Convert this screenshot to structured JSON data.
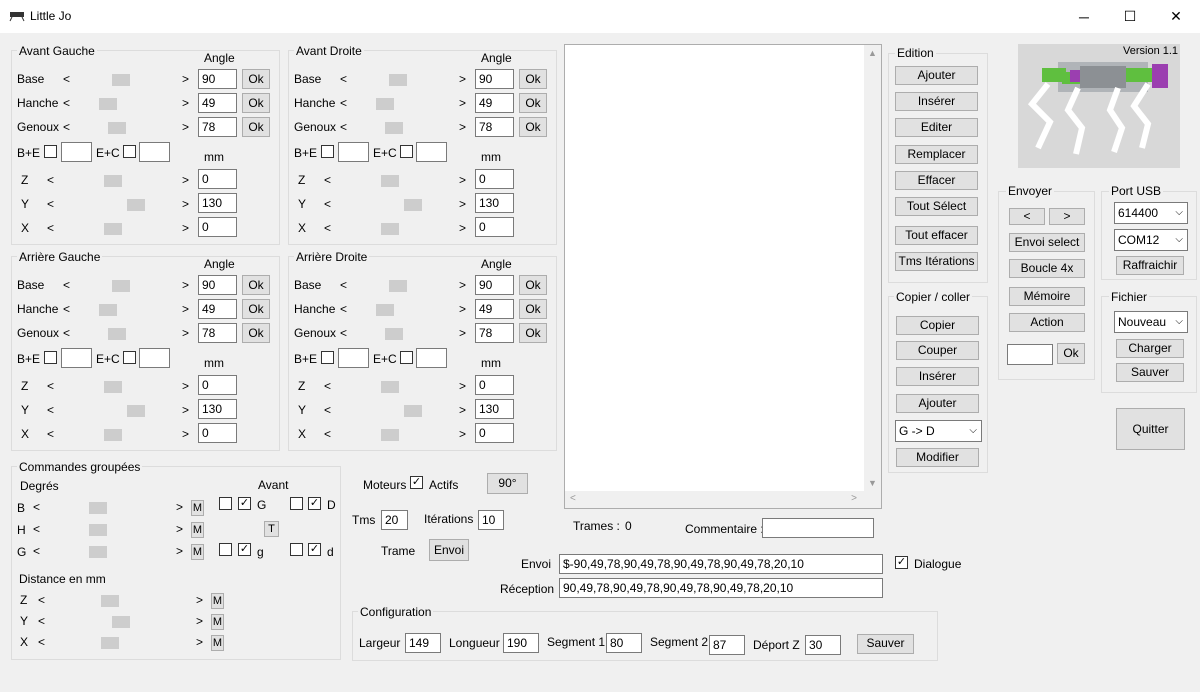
{
  "window": {
    "title": "Little Jo",
    "minimize": "─",
    "maximize": "☐",
    "close": "✕"
  },
  "legs": [
    {
      "title": "Avant Gauche",
      "angle_label": "Angle",
      "mm_label": "mm",
      "rows": [
        {
          "label": "Base",
          "value": "90",
          "ok": "Ok",
          "thumb": 0.5
        },
        {
          "label": "Hanche",
          "value": "49",
          "ok": "Ok",
          "thumb": 0.33
        },
        {
          "label": "Genoux",
          "value": "78",
          "ok": "Ok",
          "thumb": 0.45
        }
      ],
      "be": "B+E",
      "ec": "E+C",
      "xyz": [
        {
          "label": "Z",
          "value": "0",
          "thumb": 0.5
        },
        {
          "label": "Y",
          "value": "130",
          "thumb": 0.75
        },
        {
          "label": "X",
          "value": "0",
          "thumb": 0.5
        }
      ]
    },
    {
      "title": "Avant Droite",
      "angle_label": "Angle",
      "mm_label": "mm",
      "rows": [
        {
          "label": "Base",
          "value": "90",
          "ok": "Ok",
          "thumb": 0.5
        },
        {
          "label": "Hanche",
          "value": "49",
          "ok": "Ok",
          "thumb": 0.33
        },
        {
          "label": "Genoux",
          "value": "78",
          "ok": "Ok",
          "thumb": 0.45
        }
      ],
      "be": "B+E",
      "ec": "E+C",
      "xyz": [
        {
          "label": "Z",
          "value": "0",
          "thumb": 0.5
        },
        {
          "label": "Y",
          "value": "130",
          "thumb": 0.75
        },
        {
          "label": "X",
          "value": "0",
          "thumb": 0.5
        }
      ]
    },
    {
      "title": "Arrière Gauche",
      "angle_label": "Angle",
      "mm_label": "mm",
      "rows": [
        {
          "label": "Base",
          "value": "90",
          "ok": "Ok",
          "thumb": 0.5
        },
        {
          "label": "Hanche",
          "value": "49",
          "ok": "Ok",
          "thumb": 0.33
        },
        {
          "label": "Genoux",
          "value": "78",
          "ok": "Ok",
          "thumb": 0.45
        }
      ],
      "be": "B+E",
      "ec": "E+C",
      "xyz": [
        {
          "label": "Z",
          "value": "0",
          "thumb": 0.5
        },
        {
          "label": "Y",
          "value": "130",
          "thumb": 0.75
        },
        {
          "label": "X",
          "value": "0",
          "thumb": 0.5
        }
      ]
    },
    {
      "title": "Arrière Droite",
      "angle_label": "Angle",
      "mm_label": "mm",
      "rows": [
        {
          "label": "Base",
          "value": "90",
          "ok": "Ok",
          "thumb": 0.5
        },
        {
          "label": "Hanche",
          "value": "49",
          "ok": "Ok",
          "thumb": 0.33
        },
        {
          "label": "Genoux",
          "value": "78",
          "ok": "Ok",
          "thumb": 0.45
        }
      ],
      "be": "B+E",
      "ec": "E+C",
      "xyz": [
        {
          "label": "Z",
          "value": "0",
          "thumb": 0.5
        },
        {
          "label": "Y",
          "value": "130",
          "thumb": 0.75
        },
        {
          "label": "X",
          "value": "0",
          "thumb": 0.5
        }
      ]
    }
  ],
  "grouped": {
    "title": "Commandes groupées",
    "degrees": "Degrés",
    "avant": "Avant",
    "deg_rows": [
      {
        "label": "B",
        "m": "M"
      },
      {
        "label": "H",
        "m": "M"
      },
      {
        "label": "G",
        "m": "M"
      }
    ],
    "t_btn": "T",
    "g_upper": "G",
    "d_upper": "D",
    "g_lower": "g",
    "d_lower": "d",
    "distance": "Distance en mm",
    "dist_rows": [
      {
        "label": "Z",
        "m": "M"
      },
      {
        "label": "Y",
        "m": "M"
      },
      {
        "label": "X",
        "m": "M"
      }
    ]
  },
  "motors": {
    "label": "Moteurs",
    "actifs": "Actifs",
    "deg90": "90°",
    "tms": "Tms",
    "tms_value": "20",
    "iterations": "Itérations",
    "iter_value": "10",
    "trame": "Trame",
    "envoi_btn": "Envoi"
  },
  "frames": {
    "trames_label": "Trames :",
    "trames_value": "0",
    "comment_label": "Commentaire :",
    "comment_value": ""
  },
  "io": {
    "envoi_label": "Envoi",
    "envoi_value": "$-90,49,78,90,49,78,90,49,78,90,49,78,20,10",
    "reception_label": "Réception",
    "reception_value": "90,49,78,90,49,78,90,49,78,90,49,78,20,10",
    "dialogue": "Dialogue"
  },
  "config": {
    "title": "Configuration",
    "largeur": "Largeur",
    "largeur_v": "149",
    "longueur": "Longueur",
    "longueur_v": "190",
    "seg1": "Segment 1",
    "seg1_v": "80",
    "seg2": "Segment 2",
    "seg2_v": "87",
    "deport": "Déport Z",
    "deport_v": "30",
    "save": "Sauver"
  },
  "edition": {
    "title": "Edition",
    "buttons": [
      "Ajouter",
      "Insérer",
      "Editer",
      "Remplacer",
      "Effacer",
      "Tout Sélect",
      "Tout effacer",
      "Tms Itérations"
    ]
  },
  "copy": {
    "title": "Copier / coller",
    "buttons": [
      "Copier",
      "Couper",
      "Insérer",
      "Ajouter"
    ],
    "combo": "G -> D",
    "modify": "Modifier"
  },
  "send": {
    "title": "Envoyer",
    "prev": "<",
    "next": ">",
    "select": "Envoi select",
    "loop": "Boucle 4x",
    "memory": "Mémoire",
    "action": "Action",
    "ok": "Ok",
    "value": ""
  },
  "usb": {
    "title": "Port USB",
    "baud": "614400",
    "port": "COM12",
    "refresh": "Raffraichir"
  },
  "file": {
    "title": "Fichier",
    "new": "Nouveau",
    "load": "Charger",
    "save": "Sauver"
  },
  "version": "Version 1.1",
  "quit": "Quitter",
  "colors": {
    "accent_green": "#5fbf3f",
    "accent_purple": "#9b3fb0"
  }
}
